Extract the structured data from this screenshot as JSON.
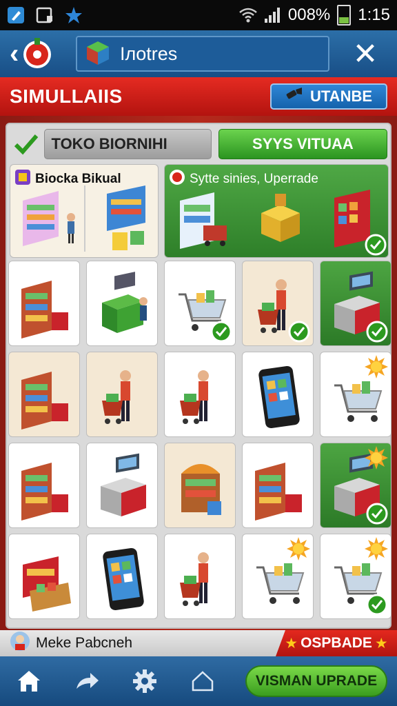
{
  "status_bar": {
    "battery": "008%",
    "time": "1:15"
  },
  "app_bar": {
    "title": "Iлotres"
  },
  "header": {
    "title": "SIMULLAIIS",
    "button_label": "UTANBE"
  },
  "tabs": {
    "left_label": "TOKO BIORNIHI",
    "right_label": "SYYS VITUAA"
  },
  "featured": [
    {
      "title": "Biocka Bikual"
    },
    {
      "title": "Sytte sinies, Uperrade"
    }
  ],
  "tiles": [
    {
      "icon": "shelf-icon",
      "style": "white",
      "checked": false,
      "sun": false
    },
    {
      "icon": "kiosk-icon",
      "style": "white",
      "checked": false,
      "sun": false
    },
    {
      "icon": "cart-icon",
      "style": "white",
      "checked": true,
      "sun": false
    },
    {
      "icon": "shopper-icon",
      "style": "beige",
      "checked": true,
      "sun": false
    },
    {
      "icon": "register-icon",
      "style": "green",
      "checked": true,
      "sun": false
    },
    {
      "icon": "shelf-icon",
      "style": "beige",
      "checked": false,
      "sun": false
    },
    {
      "icon": "shopper-icon",
      "style": "beige",
      "checked": false,
      "sun": false
    },
    {
      "icon": "shopper-icon",
      "style": "white",
      "checked": false,
      "sun": false
    },
    {
      "icon": "phone-icon",
      "style": "white",
      "checked": false,
      "sun": false
    },
    {
      "icon": "cart-icon",
      "style": "white",
      "checked": false,
      "sun": true
    },
    {
      "icon": "shelf-icon",
      "style": "white",
      "checked": false,
      "sun": false
    },
    {
      "icon": "register-icon",
      "style": "white",
      "checked": false,
      "sun": false
    },
    {
      "icon": "stall-icon",
      "style": "beige",
      "checked": false,
      "sun": false
    },
    {
      "icon": "shelf-icon",
      "style": "white",
      "checked": false,
      "sun": false
    },
    {
      "icon": "register-icon",
      "style": "green",
      "checked": true,
      "sun": true
    },
    {
      "icon": "crate-icon",
      "style": "white",
      "checked": false,
      "sun": false
    },
    {
      "icon": "phone-icon",
      "style": "white",
      "checked": false,
      "sun": false
    },
    {
      "icon": "shopper-icon",
      "style": "white",
      "checked": false,
      "sun": false
    },
    {
      "icon": "cart-icon",
      "style": "white",
      "checked": false,
      "sun": true
    },
    {
      "icon": "cart-icon",
      "style": "white",
      "checked": true,
      "sun": true
    }
  ],
  "info_bar": {
    "user_name": "Meke Pabcneh",
    "rank_label": "OSPBADE"
  },
  "nav": {
    "items": [
      "home-icon",
      "share-icon",
      "gear-icon",
      "house-outline-icon"
    ],
    "cta_label": "VISMAN UPRADE"
  },
  "colors": {
    "accent_red": "#d01f17",
    "accent_blue": "#1d5c99",
    "accent_green": "#3a9d1f"
  }
}
